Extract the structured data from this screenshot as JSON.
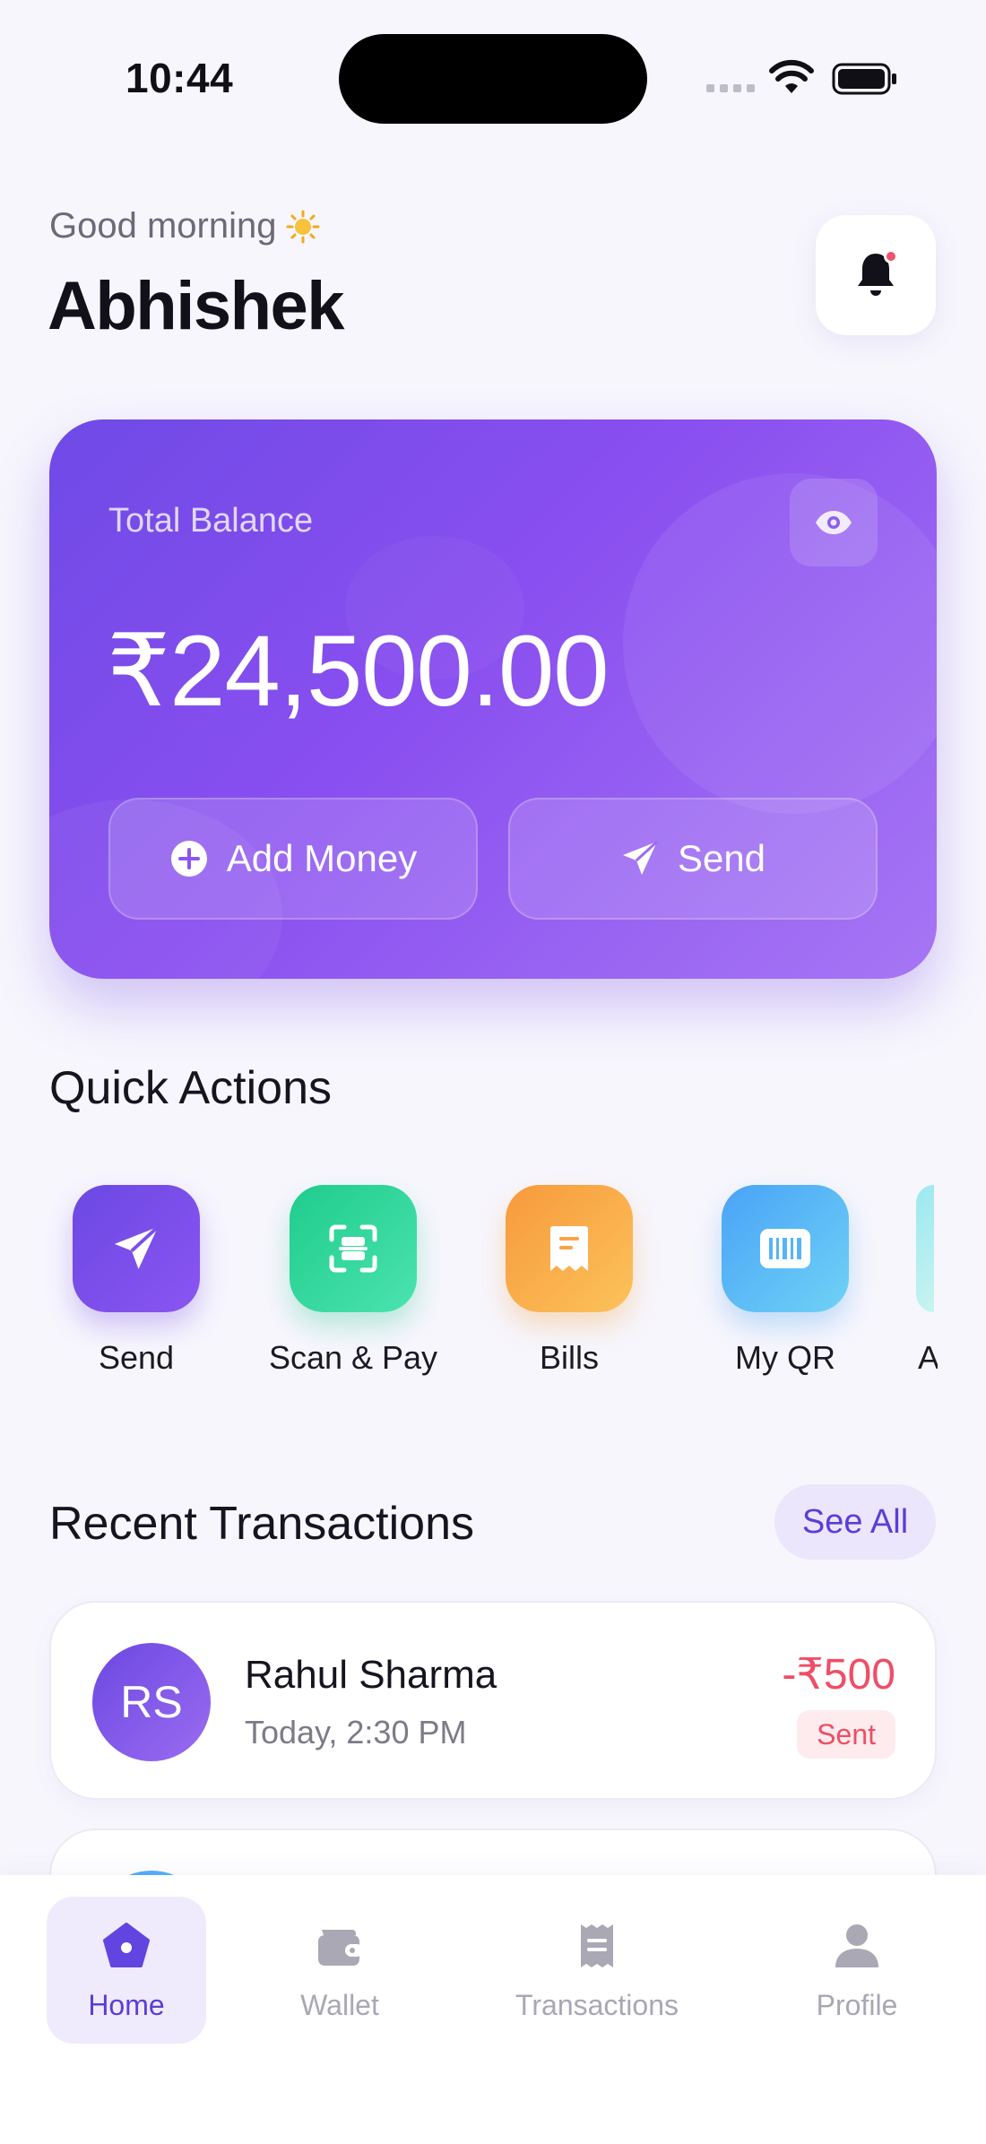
{
  "status_bar": {
    "time": "10:44"
  },
  "header": {
    "greeting": "Good morning",
    "user_name": "Abhishek"
  },
  "balance_card": {
    "label": "Total Balance",
    "amount": "₹24,500.00",
    "add_money_label": "Add Money",
    "send_label": "Send"
  },
  "quick_actions": {
    "title": "Quick Actions",
    "items": [
      {
        "label": "Send",
        "icon": "send-icon"
      },
      {
        "label": "Scan & Pay",
        "icon": "scan-icon"
      },
      {
        "label": "Bills",
        "icon": "bill-icon"
      },
      {
        "label": "My QR",
        "icon": "qr-icon"
      },
      {
        "label": "A",
        "icon": "partial-icon"
      }
    ]
  },
  "recent_transactions": {
    "title": "Recent Transactions",
    "see_all_label": "See All",
    "items": [
      {
        "initials": "RS",
        "name": "Rahul Sharma",
        "time": "Today, 2:30 PM",
        "amount": "-₹500",
        "status": "Sent"
      }
    ]
  },
  "bottom_nav": {
    "items": [
      {
        "label": "Home",
        "icon": "home-icon",
        "active": true
      },
      {
        "label": "Wallet",
        "icon": "wallet-icon",
        "active": false
      },
      {
        "label": "Transactions",
        "icon": "receipt-icon",
        "active": false
      },
      {
        "label": "Profile",
        "icon": "user-icon",
        "active": false
      }
    ]
  },
  "colors": {
    "accent": "#6f4ae6",
    "debit": "#ee4f67",
    "background": "#f7f6fd"
  }
}
